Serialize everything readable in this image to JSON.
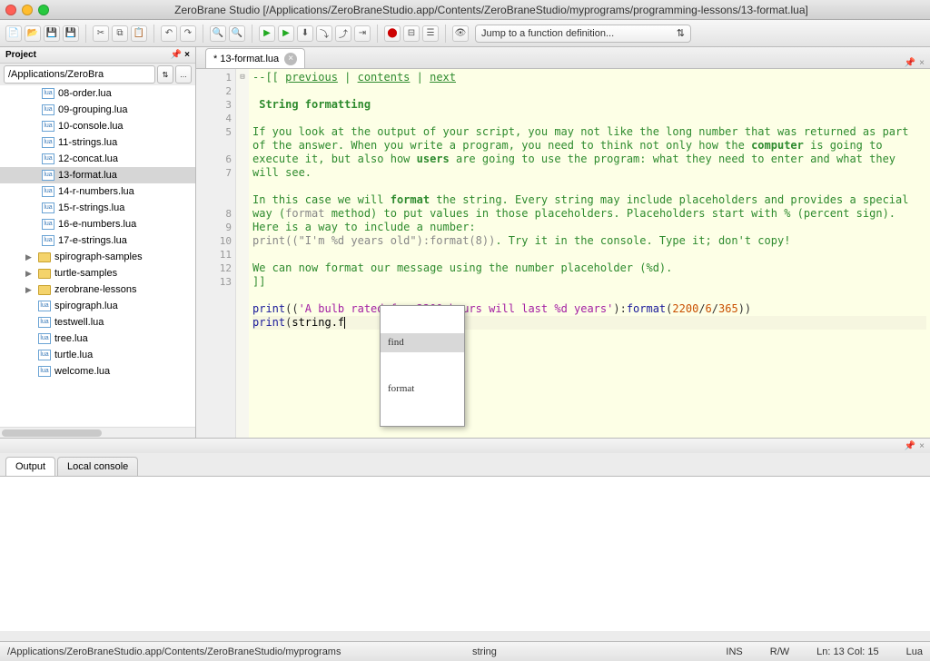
{
  "window": {
    "title": "ZeroBrane Studio [/Applications/ZeroBraneStudio.app/Contents/ZeroBraneStudio/myprograms/programming-lessons/13-format.lua]"
  },
  "toolbar": {
    "func_placeholder": "Jump to a function definition..."
  },
  "project": {
    "label": "Project",
    "path": "/Applications/ZeroBra",
    "files": [
      {
        "name": "08-order.lua",
        "type": "file"
      },
      {
        "name": "09-grouping.lua",
        "type": "file"
      },
      {
        "name": "10-console.lua",
        "type": "file"
      },
      {
        "name": "11-strings.lua",
        "type": "file"
      },
      {
        "name": "12-concat.lua",
        "type": "file"
      },
      {
        "name": "13-format.lua",
        "type": "file",
        "selected": true
      },
      {
        "name": "14-r-numbers.lua",
        "type": "file"
      },
      {
        "name": "15-r-strings.lua",
        "type": "file"
      },
      {
        "name": "16-e-numbers.lua",
        "type": "file"
      },
      {
        "name": "17-e-strings.lua",
        "type": "file"
      },
      {
        "name": "spirograph-samples",
        "type": "folder"
      },
      {
        "name": "turtle-samples",
        "type": "folder"
      },
      {
        "name": "zerobrane-lessons",
        "type": "folder"
      },
      {
        "name": "spirograph.lua",
        "type": "rootfile"
      },
      {
        "name": "testwell.lua",
        "type": "rootfile"
      },
      {
        "name": "tree.lua",
        "type": "rootfile"
      },
      {
        "name": "turtle.lua",
        "type": "rootfile"
      },
      {
        "name": "welcome.lua",
        "type": "rootfile"
      }
    ]
  },
  "tabs": {
    "active": "* 13-format.lua"
  },
  "editor": {
    "gutter": [
      "1",
      "2",
      "3",
      "4",
      "5",
      "",
      "6",
      "7",
      "",
      "",
      "8",
      "9",
      "10",
      "11",
      "12",
      "13"
    ],
    "links": {
      "prev": "previous",
      "contents": "contents",
      "next": "next"
    },
    "heading": "String formatting",
    "para1a": "If you look at the output of your script, you may not like the long number that was returned as part of the answer. When you write a program, you need to think not only how the ",
    "para1_computer": "computer",
    "para1b": " is going to execute it, but also how ",
    "para1_users": "users",
    "para1c": " are going to use the program: what they need to enter and what they will see.",
    "para2a": "In this case we will ",
    "para2_format": "format",
    "para2b": " the string. Every string may include placeholders and provides a special way (",
    "para2_code1": "format",
    "para2c": " method) to put values in those placeholders. Placeholders start with % (percent sign). Here is a way to include a number: ",
    "para2_code2": "print((\"I'm %d years old\"):format(8))",
    "para2d": ". Try it in the console. Type it; don't copy!",
    "para3": "We can now format our message using the number placeholder (%d).",
    "close_comment": "]]",
    "line12_print": "print",
    "line12_str": "'A bulb rated for 2200 hours will last %d years'",
    "line12_format": "format",
    "line12_num1": "2200",
    "line12_num2": "6",
    "line12_num3": "365",
    "line13_print": "print",
    "line13_id": "string.f"
  },
  "autocomplete": {
    "items": [
      "find",
      "format"
    ],
    "selected": 0
  },
  "bottom": {
    "tab1": "Output",
    "tab2": "Local console"
  },
  "status": {
    "path": "/Applications/ZeroBraneStudio.app/Contents/ZeroBraneStudio/myprograms",
    "type": "string",
    "ins": "INS",
    "rw": "R/W",
    "pos": "Ln: 13 Col: 15",
    "lang": "Lua"
  }
}
